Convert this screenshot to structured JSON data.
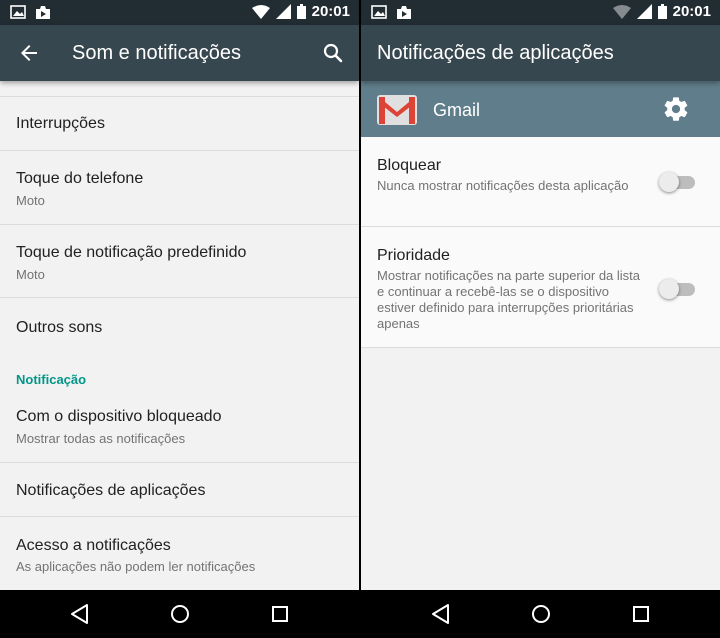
{
  "status_bar": {
    "time": "20:01",
    "icons": [
      "gallery-icon",
      "camera-store-icon",
      "wifi-icon",
      "signal-icon",
      "battery-icon"
    ]
  },
  "left_screen": {
    "toolbar": {
      "title": "Som e notificações",
      "back_icon": "arrow-back-icon",
      "search_icon": "search-icon"
    },
    "items": [
      {
        "title": "Interrupções",
        "subtitle": ""
      },
      {
        "title": "Toque do telefone",
        "subtitle": "Moto"
      },
      {
        "title": "Toque de notificação predefinido",
        "subtitle": "Moto"
      },
      {
        "title": "Outros sons",
        "subtitle": ""
      }
    ],
    "section_header": "Notificação",
    "notification_items": [
      {
        "title": "Com o dispositivo bloqueado",
        "subtitle": "Mostrar todas as notificações"
      },
      {
        "title": "Notificações de aplicações",
        "subtitle": ""
      },
      {
        "title": "Acesso a notificações",
        "subtitle": "As aplicações não podem ler notificações"
      }
    ]
  },
  "right_screen": {
    "toolbar": {
      "title": "Notificações de aplicações"
    },
    "app": {
      "name": "Gmail",
      "icon": "gmail-icon",
      "settings_icon": "gear-icon"
    },
    "preferences": [
      {
        "title": "Bloquear",
        "subtitle": "Nunca mostrar notificações desta aplicação",
        "enabled": false
      },
      {
        "title": "Prioridade",
        "subtitle": "Mostrar notificações na parte superior da lista e continuar a recebê-las se o dispositivo estiver definido para interrupções prioritárias apenas",
        "enabled": false
      }
    ]
  },
  "nav_bar": {
    "icons": [
      "nav-back-icon",
      "nav-home-icon",
      "nav-recents-icon"
    ]
  },
  "colors": {
    "status_bar": "#222d33",
    "toolbar": "#37474f",
    "app_header": "#607d8b",
    "accent": "#009688",
    "background": "#f2f2f2",
    "gmail_red": "#db4437"
  }
}
